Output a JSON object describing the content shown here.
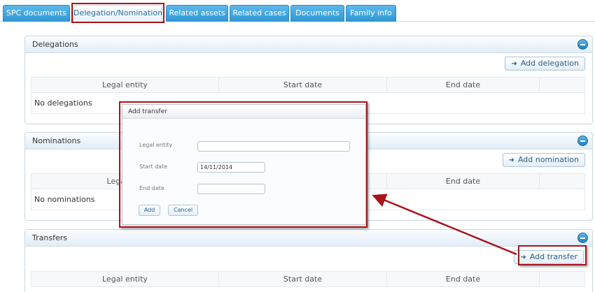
{
  "tabs": [
    {
      "label": "SPC documents"
    },
    {
      "label": "Delegation/Nomination"
    },
    {
      "label": "Related assets"
    },
    {
      "label": "Related cases"
    },
    {
      "label": "Documents"
    },
    {
      "label": "Family info"
    }
  ],
  "delegations": {
    "title": "Delegations",
    "add_label": "Add delegation",
    "columns": [
      "Legal entity",
      "Start date",
      "End date"
    ],
    "empty_text": "No delegations"
  },
  "nominations": {
    "title": "Nominations",
    "add_label": "Add nomination",
    "columns": [
      "Legal",
      "End date"
    ],
    "empty_text": "No nominations"
  },
  "transfers": {
    "title": "Transfers",
    "add_label": "Add transfer",
    "columns": [
      "Legal entity",
      "Start date",
      "End date"
    ]
  },
  "dialog": {
    "title": "Add transfer",
    "legal_entity_label": "Legal entity",
    "legal_entity_value": "",
    "start_date_label": "Start date",
    "start_date_value": "14/11/2014",
    "end_date_label": "End date",
    "end_date_value": "",
    "add_label": "Add",
    "cancel_label": "Cancel"
  },
  "colors": {
    "annotation": "#a8141a",
    "tab_blue": "#2e97d4"
  },
  "icons": {
    "add_arrow": "arrow-right-icon",
    "collapse": "minus-circle-icon"
  }
}
